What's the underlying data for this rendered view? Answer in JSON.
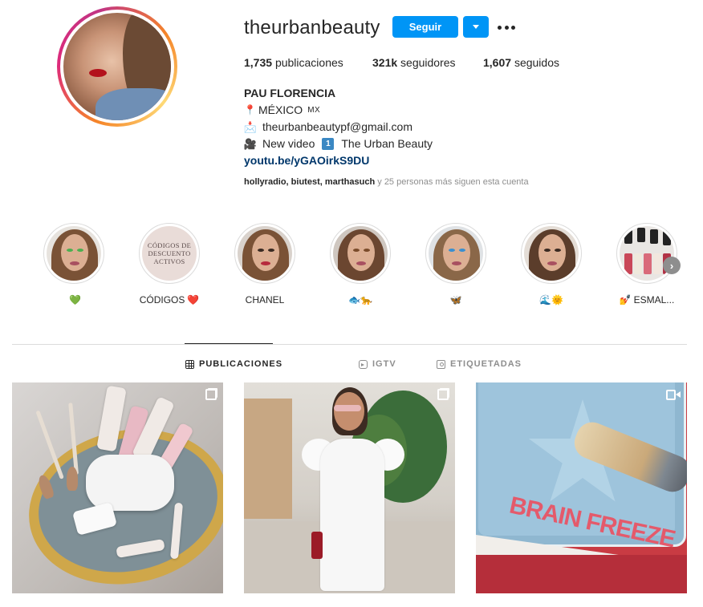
{
  "profile": {
    "username": "theurbanbeauty",
    "follow_label": "Seguir",
    "stats": {
      "posts_count": "1,735",
      "posts_label": "publicaciones",
      "followers_count": "321k",
      "followers_label": "seguidores",
      "following_count": "1,607",
      "following_label": "seguidos"
    },
    "bio": {
      "full_name": "PAU FLORENCIA",
      "location_icon": "📍",
      "location": "MÉXICO",
      "location_suffix": "MX",
      "email_icon": "📩",
      "email": "theurbanbeautypf@gmail.com",
      "video_icon": "🎥",
      "video_text": "New video",
      "video_number": "1",
      "video_title": "The Urban Beauty",
      "link": "youtu.be/yGAOirkS9DU"
    },
    "followed_by": {
      "names": "hollyradio, biutest, marthasuch",
      "rest": " y 25 personas más siguen esta cuenta"
    }
  },
  "highlights": [
    {
      "label": "",
      "emoji": "💚"
    },
    {
      "label": "CÓDIGOS",
      "emoji": "❤️",
      "cover_text": "CÓDIGOS DE DESCUENTO ACTIVOS"
    },
    {
      "label": "CHANEL",
      "emoji": ""
    },
    {
      "label": "",
      "emoji": "🐟🐆"
    },
    {
      "label": "",
      "emoji": "🦋"
    },
    {
      "label": "",
      "emoji": "🌊🌞"
    },
    {
      "label": "ESMAL...",
      "emoji": "💅"
    }
  ],
  "tabs": [
    {
      "label": "PUBLICACIONES",
      "active": true,
      "icon": "grid-icon"
    },
    {
      "label": "IGTV",
      "active": false,
      "icon": "igtv-icon"
    },
    {
      "label": "ETIQUETADAS",
      "active": false,
      "icon": "tagged-icon"
    }
  ],
  "posts": [
    {
      "type": "carousel",
      "icon": "carousel-icon"
    },
    {
      "type": "carousel",
      "icon": "carousel-icon"
    },
    {
      "type": "video",
      "icon": "video-icon",
      "overlay_text": "BRAIN FREEZE"
    }
  ],
  "colors": {
    "accent": "#0095f6",
    "link": "#00376b",
    "muted": "#8e8e8e",
    "text": "#262626"
  }
}
